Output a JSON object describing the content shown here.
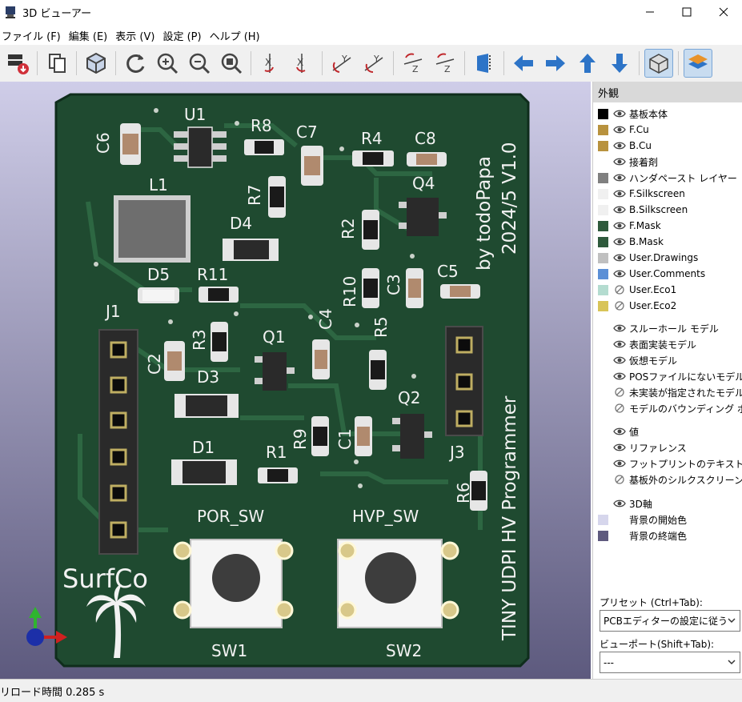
{
  "window": {
    "title": "3D ビューアー"
  },
  "menu": [
    "ファイル (F)",
    "編集 (E)",
    "表示 (V)",
    "設定 (P)",
    "ヘルプ (H)"
  ],
  "panel": {
    "title": "外観",
    "layers": [
      {
        "label": "基板本体",
        "color": "#000000",
        "visible": true
      },
      {
        "label": "F.Cu",
        "color": "#b8923e",
        "visible": true
      },
      {
        "label": "B.Cu",
        "color": "#b8923e",
        "visible": true
      },
      {
        "label": "接着剤",
        "color": "",
        "visible": true
      },
      {
        "label": "ハンダペースト レイヤー",
        "color": "#808080",
        "visible": true
      },
      {
        "label": "F.Silkscreen",
        "color": "#f0f0f0",
        "visible": true
      },
      {
        "label": "B.Silkscreen",
        "color": "#f0f0f0",
        "visible": true
      },
      {
        "label": "F.Mask",
        "color": "#2e5a3c",
        "visible": true
      },
      {
        "label": "B.Mask",
        "color": "#2e5a3c",
        "visible": true
      },
      {
        "label": "User.Drawings",
        "color": "#c0c0c0",
        "visible": true
      },
      {
        "label": "User.Comments",
        "color": "#5b8fd6",
        "visible": true
      },
      {
        "label": "User.Eco1",
        "color": "#b4dcd0",
        "visible": false
      },
      {
        "label": "User.Eco2",
        "color": "#d8c458",
        "visible": false
      }
    ],
    "models": [
      {
        "label": "スルーホール モデル",
        "visible": true
      },
      {
        "label": "表面実装モデル",
        "visible": true
      },
      {
        "label": "仮想モデル",
        "visible": true
      },
      {
        "label": "POSファイルにないモデル",
        "visible": true
      },
      {
        "label": "未実装が指定されたモデル",
        "visible": false
      },
      {
        "label": "モデルのバウンディング ボックス",
        "visible": false
      }
    ],
    "texts": [
      {
        "label": "値",
        "visible": true
      },
      {
        "label": "リファレンス",
        "visible": true
      },
      {
        "label": "フットプリントのテキスト",
        "visible": true
      },
      {
        "label": "基板外のシルクスクリーン",
        "visible": false
      }
    ],
    "axis": {
      "label": "3D軸",
      "visible": true
    },
    "bg": [
      {
        "label": "背景の開始色",
        "color": "#d6d6ec"
      },
      {
        "label": "背景の終端色",
        "color": "#5e5a7e"
      }
    ],
    "preset_label": "プリセット (Ctrl+Tab):",
    "preset_value": "PCBエディターの設定に従う",
    "viewport_label": "ビューポート(Shift+Tab):",
    "viewport_value": "---"
  },
  "pcb": {
    "refs": [
      "C6",
      "U1",
      "R8",
      "C7",
      "R4",
      "C8",
      "L1",
      "R7",
      "Q4",
      "D4",
      "R2",
      "D5",
      "R11",
      "R10",
      "C3",
      "C5",
      "J1",
      "R3",
      "Q1",
      "C4",
      "R5",
      "C2",
      "D3",
      "Q2",
      "J3",
      "R9",
      "C1",
      "D1",
      "R1",
      "R6",
      "POR_SW",
      "HVP_SW",
      "SW1",
      "SW2"
    ],
    "board_text": [
      "by todoPapa",
      "2024/5 V1.0",
      "TINY UDPI HV Programmer"
    ],
    "logo": "SurfCo"
  },
  "status": {
    "text": "リロード時間 0.285 s"
  }
}
